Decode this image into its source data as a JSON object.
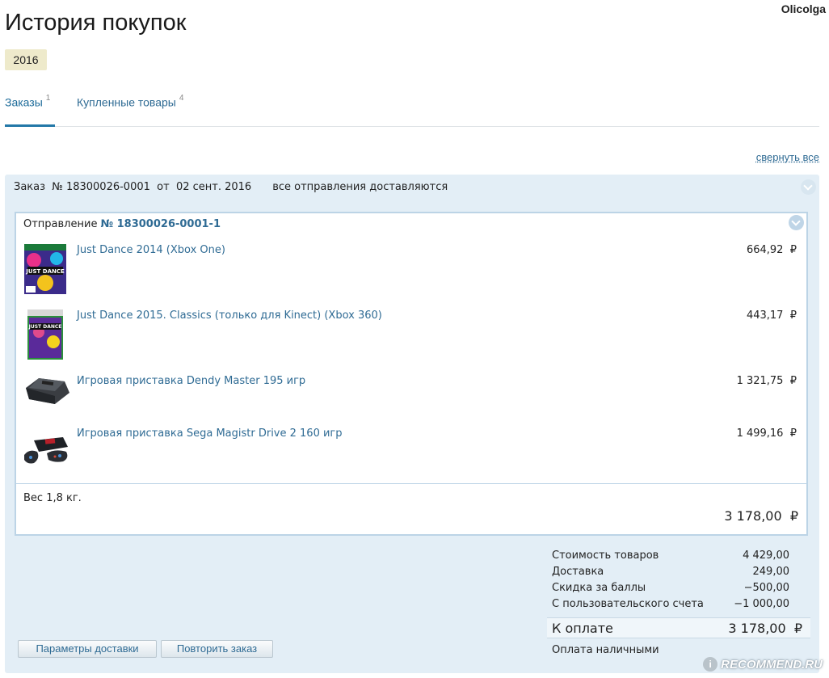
{
  "user": {
    "name": "Olicolga"
  },
  "page": {
    "title": "История покупок",
    "year": "2016"
  },
  "tabs": [
    {
      "label": "Заказы",
      "count": "1"
    },
    {
      "label": "Купленные товары",
      "count": "4"
    }
  ],
  "collapse_all": "свернуть все",
  "order": {
    "header": "Заказ  № 18300026-0001  от  02 сент. 2016",
    "status": "все отправления доставляются",
    "shipment": {
      "label": "Отправление",
      "number": "№ 18300026-0001-1",
      "items": [
        {
          "name": "Just Dance 2014 (Xbox One)",
          "price": "664,92  ₽"
        },
        {
          "name": "Just Dance 2015. Classics (только для Kinect) (Xbox 360)",
          "price": "443,17  ₽"
        },
        {
          "name": "Игровая приставка Dendy Master 195 игр",
          "price": "1 321,75  ₽"
        },
        {
          "name": "Игровая приставка Sega Magistr Drive 2 160 игр",
          "price": "1 499,16  ₽"
        }
      ],
      "weight": "Вес 1,8 кг.",
      "total": "3 178,00  ₽"
    },
    "summary": {
      "rows": [
        {
          "label": "Стоимость товаров",
          "value": "4 429,00"
        },
        {
          "label": "Доставка",
          "value": "249,00"
        },
        {
          "label": "Скидка за баллы",
          "value": "−500,00"
        },
        {
          "label": "С пользовательского счета",
          "value": "−1 000,00"
        }
      ],
      "to_pay_label": "К оплате",
      "to_pay_value": "3 178,00  ₽",
      "payment_method": "Оплата наличными"
    },
    "buttons": {
      "delivery_params": "Параметры доставки",
      "repeat_order": "Повторить заказ"
    }
  },
  "watermark": "RECOMMEND.RU",
  "icons": [
    "chevron-down-icon",
    "just-dance-2014-cover",
    "just-dance-2015-cover",
    "dendy-console-image",
    "sega-console-image",
    "recommend-logo-icon"
  ],
  "colors": {
    "link": "#2f6b94",
    "order_bg": "#e3eef6",
    "shipment_border": "#bcd4e6",
    "year_chip": "#eeeacb"
  }
}
